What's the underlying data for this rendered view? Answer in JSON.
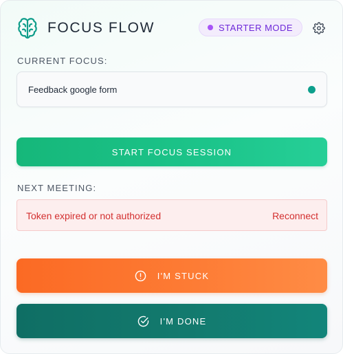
{
  "header": {
    "app_title": "FOCUS FLOW",
    "mode_badge": "STARTER MODE",
    "icons": {
      "logo": "brain-icon",
      "settings": "gear-icon"
    }
  },
  "current_focus": {
    "label": "CURRENT FOCUS:",
    "value": "Feedback google form",
    "status_color": "#0d9f8c"
  },
  "start_button": {
    "label": "START FOCUS SESSION"
  },
  "next_meeting": {
    "label": "NEXT MEETING:",
    "error_text": "Token expired or not authorized",
    "reconnect_label": "Reconnect"
  },
  "stuck_button": {
    "label": "I'M STUCK",
    "icon": "alert-circle-icon"
  },
  "done_button": {
    "label": "I'M DONE",
    "icon": "check-circle-icon"
  },
  "colors": {
    "brand_teal": "#0f9d8a",
    "start_green": "#1cc48a",
    "stuck_orange": "#fd7b34",
    "done_teal": "#137a6e",
    "error_red": "#d32f2f",
    "badge_purple": "#6d28d9"
  }
}
